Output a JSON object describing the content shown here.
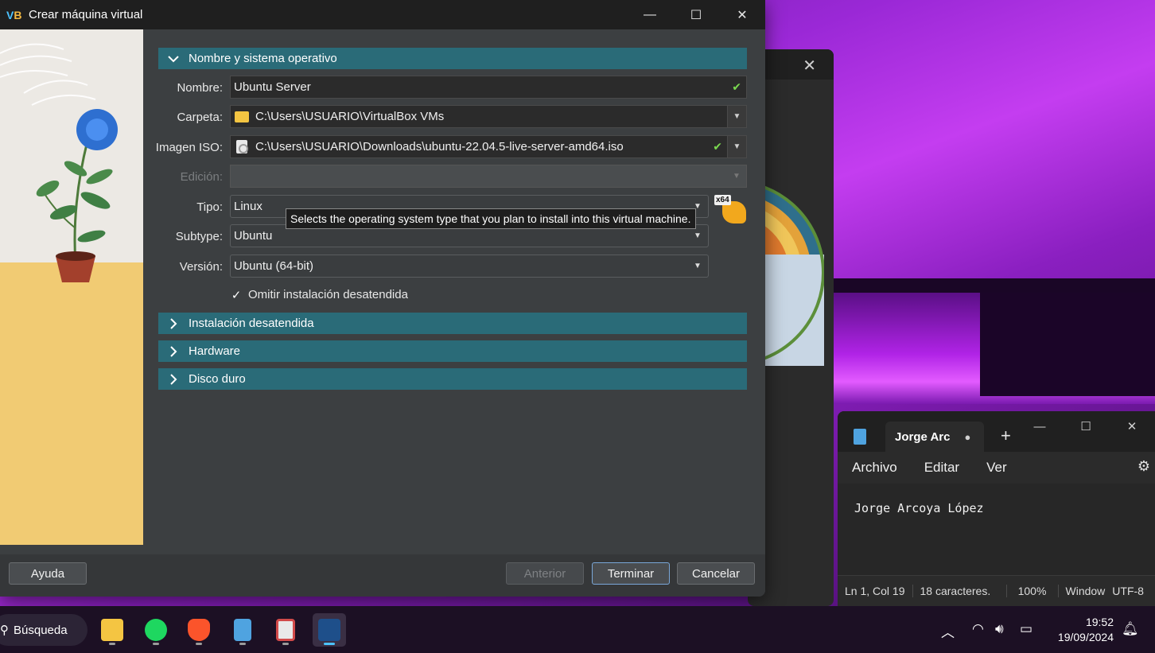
{
  "dialog": {
    "title": "Crear máquina virtual",
    "sections": {
      "name_os": "Nombre y sistema operativo",
      "unattended": "Instalación desatendida",
      "hardware": "Hardware",
      "disk": "Disco duro"
    },
    "labels": {
      "name": "Nombre:",
      "folder": "Carpeta:",
      "iso": "Imagen ISO:",
      "edition": "Edición:",
      "type": "Tipo:",
      "subtype": "Subtype:",
      "version": "Versión:"
    },
    "fields": {
      "name": "Ubuntu Server",
      "folder": "C:\\Users\\USUARIO\\VirtualBox VMs",
      "iso": "C:\\Users\\USUARIO\\Downloads\\ubuntu-22.04.5-live-server-amd64.iso",
      "edition": "",
      "type": "Linux",
      "subtype": "Ubuntu",
      "version": "Ubuntu (64-bit)"
    },
    "os_badge": "x64",
    "tooltip": "Selects the operating system type that you plan to install into this virtual machine.",
    "skip_unattended": {
      "label": "Omitir instalación desatendida",
      "checked": true
    },
    "buttons": {
      "help": "Ayuda",
      "back": "Anterior",
      "finish": "Terminar",
      "cancel": "Cancelar"
    }
  },
  "notepad": {
    "tab_title": "Jorge Arc",
    "menu": [
      "Archivo",
      "Editar",
      "Ver"
    ],
    "content": "Jorge Arcoya López",
    "status": {
      "position": "Ln 1, Col 19",
      "chars": "18 caracteres.",
      "zoom": "100%",
      "eol": "Window",
      "encoding": "UTF-8"
    }
  },
  "taskbar": {
    "search_label": "Búsqueda",
    "apps": [
      "file-explorer",
      "spotify",
      "brave",
      "notepad",
      "snipping-tool",
      "virtualbox"
    ],
    "time": "19:52",
    "date": "19/09/2024"
  },
  "colors": {
    "section_header": "#2a6b78",
    "check_green": "#7ad94f",
    "accent_blue": "#4cc3ff"
  }
}
